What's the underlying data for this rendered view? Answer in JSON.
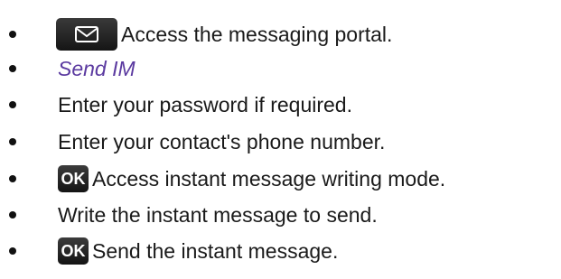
{
  "steps": [
    {
      "text": "Access the messaging portal.",
      "icon": "envelope-key-icon"
    },
    {
      "text": "Send IM",
      "style": "italic",
      "color": "#5b3aa0"
    },
    {
      "text": "Enter your password if required."
    },
    {
      "text": "Enter your contact's phone number."
    },
    {
      "text": "Access instant message writing mode.",
      "icon": "ok-key-icon",
      "icon_label": "OK"
    },
    {
      "text": "Write the instant message to send."
    },
    {
      "text": "Send the instant message.",
      "icon": "ok-key-icon",
      "icon_label": "OK"
    }
  ]
}
